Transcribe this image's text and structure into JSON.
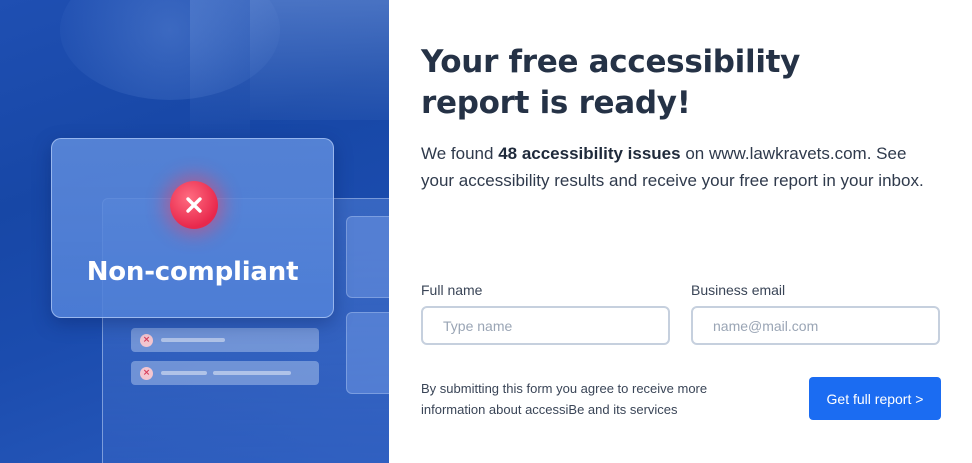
{
  "illustration": {
    "status_label": "Non-compliant",
    "badge_icon": "close-icon",
    "row_icon": "error-icon",
    "row_icon_glyph": "×"
  },
  "content": {
    "title": "Your free accessibility report is ready!",
    "description": {
      "before": "We found ",
      "highlight": "48 accessibility issues",
      "after": " on www.lawkravets.com. See your accessibility results and receive your free report in your inbox."
    }
  },
  "form": {
    "full_name": {
      "label": "Full name",
      "placeholder": "Type name",
      "value": ""
    },
    "email": {
      "label": "Business email",
      "placeholder": "name@mail.com",
      "value": ""
    },
    "consent_text": "By submitting this form you agree to receive more information about accessiBe and its services",
    "submit_label": "Get full report >"
  },
  "colors": {
    "brand_blue": "#1b6cf2",
    "panel_blue": "#1747a6",
    "error_red": "#e8284c",
    "title_text": "#253246",
    "input_border": "#c6d0de"
  }
}
